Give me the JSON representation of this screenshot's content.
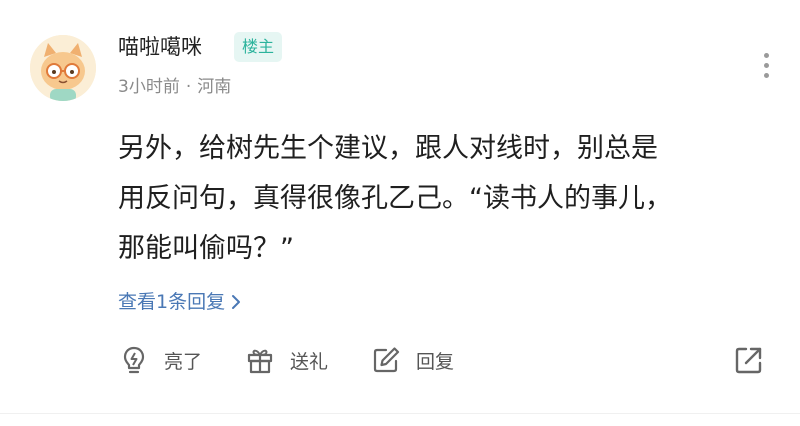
{
  "comment": {
    "username": "喵啦噶咪",
    "badge": "楼主",
    "time": "3小时前",
    "separator": "·",
    "location": "河南",
    "content_lines": [
      "另外，给树先生个建议，跟人对线时，别总是",
      "用反问句，真得很像孔乙己。“读书人的事儿，",
      "那能叫偷吗？”"
    ],
    "replies_link": "查看1条回复",
    "actions": {
      "like": "亮了",
      "gift": "送礼",
      "reply": "回复"
    }
  },
  "icons": {
    "avatar": "cartoon-cat-avatar",
    "more": "more-vertical-icon",
    "replies_chevron": "chevron-right-icon",
    "like": "lightbulb-icon",
    "gift": "gift-icon",
    "reply": "edit-icon",
    "share": "share-icon"
  },
  "colors": {
    "badge_text": "#2bb39c",
    "badge_bg": "#e6f6f3",
    "link": "#4a78b5",
    "meta": "#8a8a8a",
    "text": "#1f1f1f"
  }
}
